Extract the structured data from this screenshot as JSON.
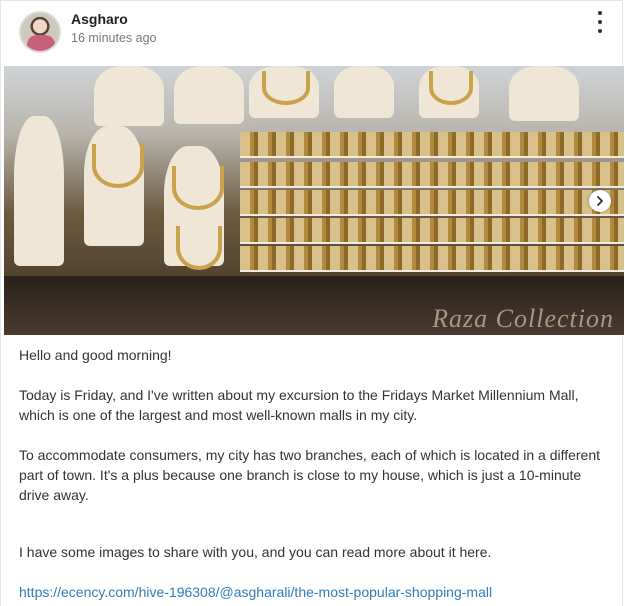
{
  "post": {
    "author": "Asgharo",
    "time": "16 minutes ago",
    "avatar_icon": "user-avatar",
    "menu_icon": "kebab-menu-icon",
    "image": {
      "watermark": "Raza Collection",
      "next_icon": "chevron-right-icon"
    },
    "paragraphs": [
      "Hello and good morning!",
      "Today is Friday, and I've written about my excursion to the Fridays Market Millennium Mall, which is one of the largest and most well-known malls in my city.",
      "To accommodate consumers, my city has two branches, each of which is located in a different part of town. It's a plus because one branch is close to my house, which is just a 10-minute drive away.",
      "I have some images to share with you, and you can read more about it here."
    ],
    "link": "https://ecency.com/hive-196308/@asgharali/the-most-popular-shopping-mall"
  },
  "colors": {
    "link": "#2f7dbd",
    "text": "#333333",
    "muted": "#777777"
  }
}
